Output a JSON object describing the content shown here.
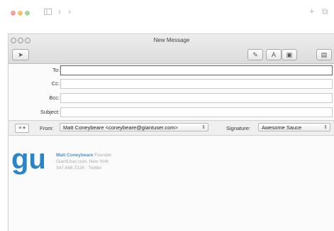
{
  "colors": {
    "accent": "#4a8fd0",
    "logo": "#2a84c8"
  },
  "outer_toolbar": {
    "sidebar_icon": "sidebar-icon",
    "back_glyph": "‹",
    "forward_glyph": "›",
    "new_tab_glyph": "+",
    "tabs_icon_glyph": "⧉"
  },
  "window": {
    "title": "New Message",
    "toolbar": {
      "send_glyph": "➤",
      "attach_glyph": "✎",
      "format_glyph": "A",
      "photo_glyph": "▣",
      "template_glyph": "▤"
    }
  },
  "fields": {
    "to_label": "To:",
    "cc_label": "Cc:",
    "bcc_label": "Bcc:",
    "subject_label": "Subject:",
    "to_value": "",
    "cc_value": "",
    "bcc_value": "",
    "subject_value": ""
  },
  "from_bar": {
    "options_glyph": "≡ ▾",
    "from_label": "From:",
    "from_value": "Matt Coneybeare <coneybeare@giantuser.com>",
    "signature_label": "Signature:",
    "signature_value": "Awesome Sauce",
    "arrows": "⇕"
  },
  "signature": {
    "logo_text": "gu",
    "name": "Matt Coneybeare",
    "role": "Founder",
    "line2": "GiantUser.com, New York",
    "line3": "347.688.7226 · Twitter"
  }
}
